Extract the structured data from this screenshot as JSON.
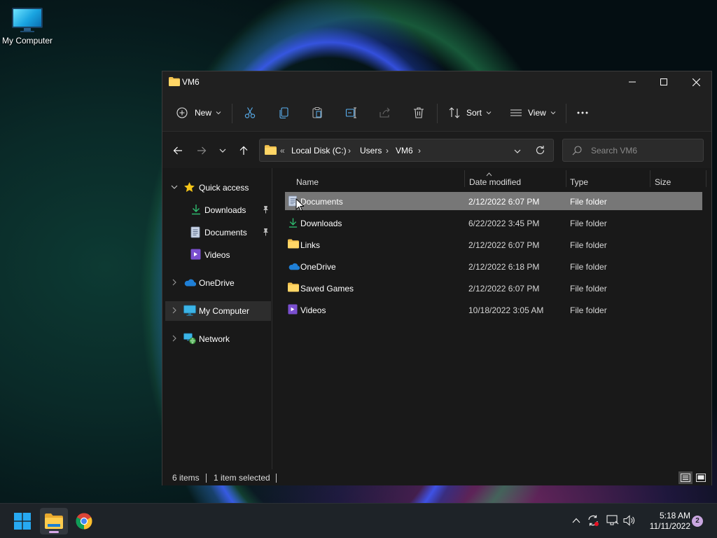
{
  "desktop": {
    "icon_label": "My Computer"
  },
  "window": {
    "title": "VM6",
    "controls": {
      "minimize": "minimize-icon",
      "maximize": "maximize-icon",
      "close": "close-icon"
    }
  },
  "toolbar": {
    "new_label": "New",
    "sort_label": "Sort",
    "view_label": "View",
    "icons": [
      "cut-icon",
      "copy-icon",
      "paste-icon",
      "rename-icon",
      "share-icon",
      "delete-icon",
      "more-icon"
    ]
  },
  "address": {
    "overflow": "«",
    "crumbs": [
      "Local Disk (C:)",
      "Users",
      "VM6"
    ],
    "search_placeholder": "Search VM6"
  },
  "nav": {
    "quick_access": "Quick access",
    "pinned": [
      {
        "label": "Downloads",
        "pinned": true
      },
      {
        "label": "Documents",
        "pinned": true
      },
      {
        "label": "Videos",
        "pinned": false
      }
    ],
    "onedrive": "OneDrive",
    "my_computer": "My Computer",
    "network": "Network"
  },
  "columns": {
    "name": "Name",
    "date": "Date modified",
    "type": "Type",
    "size": "Size"
  },
  "files": [
    {
      "name": "Documents",
      "date": "2/12/2022 6:07 PM",
      "type": "File folder",
      "icon": "documents-folder-icon",
      "selected": true
    },
    {
      "name": "Downloads",
      "date": "6/22/2022 3:45 PM",
      "type": "File folder",
      "icon": "downloads-folder-icon",
      "selected": false
    },
    {
      "name": "Links",
      "date": "2/12/2022 6:07 PM",
      "type": "File folder",
      "icon": "folder-icon",
      "selected": false
    },
    {
      "name": "OneDrive",
      "date": "2/12/2022 6:18 PM",
      "type": "File folder",
      "icon": "onedrive-icon",
      "selected": false
    },
    {
      "name": "Saved Games",
      "date": "2/12/2022 6:07 PM",
      "type": "File folder",
      "icon": "folder-icon",
      "selected": false
    },
    {
      "name": "Videos",
      "date": "10/18/2022 3:05 AM",
      "type": "File folder",
      "icon": "videos-folder-icon",
      "selected": false
    }
  ],
  "status": {
    "items": "6 items",
    "selected": "1 item selected"
  },
  "taskbar": {
    "time": "5:18 AM",
    "date": "11/11/2022",
    "notifications": "2"
  },
  "colors": {
    "accent": "#0078d4",
    "folder": "#f2c14e",
    "selected_row": "#777777",
    "window_bg": "#191919"
  }
}
